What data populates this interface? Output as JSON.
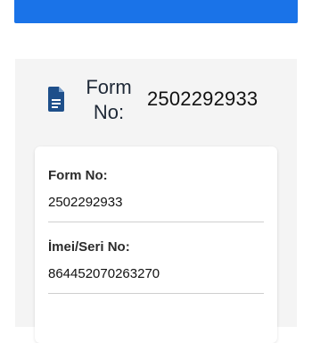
{
  "top_bar": {
    "color": "#1a73e8"
  },
  "header": {
    "icon": "document-icon",
    "label": "Form No:",
    "value": "2502292933"
  },
  "fields": [
    {
      "label": "Form No:",
      "value": "2502292933"
    },
    {
      "label": "İmei/Seri No:",
      "value": "864452070263270"
    }
  ]
}
